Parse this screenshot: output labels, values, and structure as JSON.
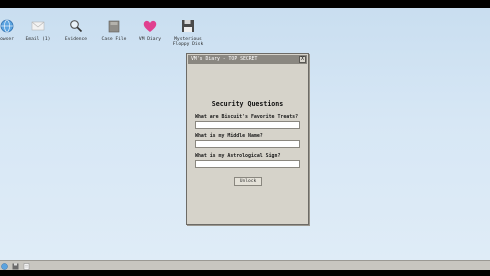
{
  "desktop_icons": [
    {
      "name": "browser-icon",
      "label": "owser"
    },
    {
      "name": "email-icon",
      "label": "Email (1)"
    },
    {
      "name": "evidence-icon",
      "label": "Evidence"
    },
    {
      "name": "case-file-icon",
      "label": "Case File"
    },
    {
      "name": "diary-icon",
      "label": "VM Diary"
    },
    {
      "name": "floppy-icon",
      "label": "Mysterious\nFloppy Disk"
    }
  ],
  "window": {
    "title": "VM's Diary - TOP SECRET",
    "close_label": "X",
    "heading": "Security Questions",
    "questions": [
      {
        "label": "What are Biscuit's Favorite Treats?",
        "value": ""
      },
      {
        "label": "What is my Middle Name?",
        "value": ""
      },
      {
        "label": "What is my Astrological Sign?",
        "value": ""
      }
    ],
    "unlock_label": "Unlock"
  },
  "colors": {
    "desktop_top": "#c9def0",
    "window_bg": "#d6d3ca",
    "titlebar_bg": "#8a8780",
    "diary_heart": "#e0408f"
  }
}
